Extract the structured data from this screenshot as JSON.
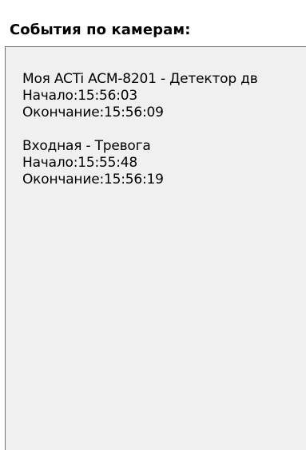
{
  "panel": {
    "title": "События по камерам:"
  },
  "events": [
    {
      "name": "Моя ACTi ACM-8201 - Детектор дв",
      "start_label": "Начало:",
      "start_time": "15:56:03",
      "end_label": "Окончание:",
      "end_time": "15:56:09"
    },
    {
      "name": "Входная - Тревога",
      "start_label": "Начало:",
      "start_time": "15:55:48",
      "end_label": "Окончание:",
      "end_time": "15:56:19"
    }
  ]
}
